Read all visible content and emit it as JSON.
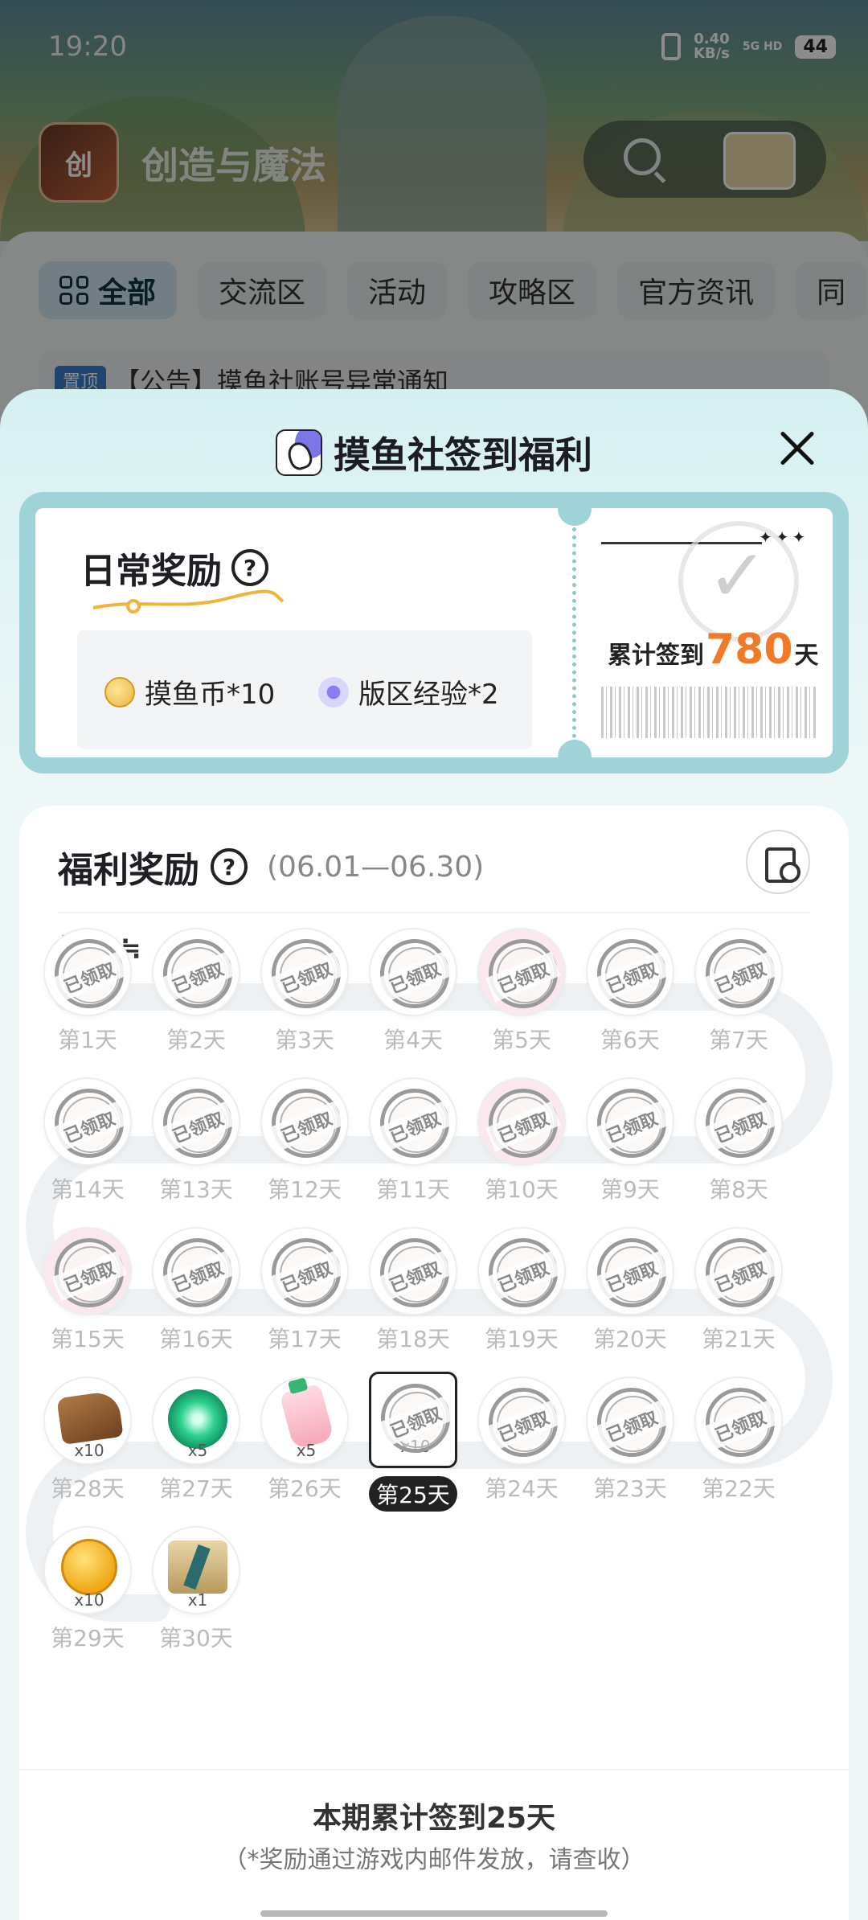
{
  "status_bar": {
    "time": "19:20",
    "speed_value": "0.40",
    "speed_unit": "KB/s",
    "network": "5G HD",
    "battery": "44"
  },
  "app_header": {
    "logo_text": "创",
    "title": "创造与魔法"
  },
  "background_tabs": [
    {
      "label": "全部",
      "active": true
    },
    {
      "label": "交流区"
    },
    {
      "label": "活动"
    },
    {
      "label": "攻略区"
    },
    {
      "label": "官方资讯"
    },
    {
      "label": "同"
    }
  ],
  "background_notice": {
    "tag": "置顶",
    "text": "【公告】摸鱼社账号异常通知"
  },
  "sheet": {
    "title": "摸鱼社签到福利",
    "daily": {
      "title": "日常奖励",
      "rewards": [
        {
          "label": "摸鱼币*10",
          "icon": "coin-icon"
        },
        {
          "label": "版区经验*2",
          "icon": "exp-icon"
        }
      ],
      "total_prefix": "累计签到",
      "total_days": "780",
      "total_suffix": "天"
    },
    "welfare": {
      "title": "福利奖励",
      "date_range": "(06.01—06.30)",
      "user_name": "楊ᵀᴱᴸ ≒",
      "days": [
        {
          "label": "第1天",
          "claimed": true,
          "claimed_text": "已领取"
        },
        {
          "label": "第2天",
          "claimed": true,
          "claimed_text": "已领取"
        },
        {
          "label": "第3天",
          "claimed": true,
          "claimed_text": "已领取"
        },
        {
          "label": "第4天",
          "claimed": true,
          "claimed_text": "已领取"
        },
        {
          "label": "第5天",
          "claimed": true,
          "claimed_text": "已领取",
          "gift": true
        },
        {
          "label": "第6天",
          "claimed": true,
          "claimed_text": "已领取"
        },
        {
          "label": "第7天",
          "claimed": true,
          "claimed_text": "已领取"
        },
        {
          "label": "第8天",
          "claimed": true,
          "claimed_text": "已领取"
        },
        {
          "label": "第9天",
          "claimed": true,
          "claimed_text": "已领取"
        },
        {
          "label": "第10天",
          "claimed": true,
          "claimed_text": "已领取",
          "gift": true
        },
        {
          "label": "第11天",
          "claimed": true,
          "claimed_text": "已领取"
        },
        {
          "label": "第12天",
          "claimed": true,
          "claimed_text": "已领取"
        },
        {
          "label": "第13天",
          "claimed": true,
          "claimed_text": "已领取"
        },
        {
          "label": "第14天",
          "claimed": true,
          "claimed_text": "已领取"
        },
        {
          "label": "第15天",
          "claimed": true,
          "claimed_text": "已领取",
          "gift": true
        },
        {
          "label": "第16天",
          "claimed": true,
          "claimed_text": "已领取"
        },
        {
          "label": "第17天",
          "claimed": true,
          "claimed_text": "已领取"
        },
        {
          "label": "第18天",
          "claimed": true,
          "claimed_text": "已领取"
        },
        {
          "label": "第19天",
          "claimed": true,
          "claimed_text": "已领取"
        },
        {
          "label": "第20天",
          "claimed": true,
          "claimed_text": "已领取"
        },
        {
          "label": "第21天",
          "claimed": true,
          "claimed_text": "已领取"
        },
        {
          "label": "第22天",
          "claimed": true,
          "claimed_text": "已领取"
        },
        {
          "label": "第23天",
          "claimed": true,
          "claimed_text": "已领取"
        },
        {
          "label": "第24天",
          "claimed": true,
          "claimed_text": "已领取"
        },
        {
          "label": "第25天",
          "claimed": true,
          "claimed_text": "已领取",
          "qty": "x10",
          "current": true
        },
        {
          "label": "第26天",
          "qty": "x5",
          "item": "potion"
        },
        {
          "label": "第27天",
          "qty": "x5",
          "item": "gem"
        },
        {
          "label": "第28天",
          "qty": "x10",
          "item": "bag"
        },
        {
          "label": "第29天",
          "qty": "x10",
          "item": "gold"
        },
        {
          "label": "第30天",
          "qty": "x1",
          "item": "scroll"
        }
      ]
    },
    "footer": {
      "total": "本期累计签到25天",
      "note": "（*奖励通过游戏内邮件发放，请查收）"
    }
  }
}
